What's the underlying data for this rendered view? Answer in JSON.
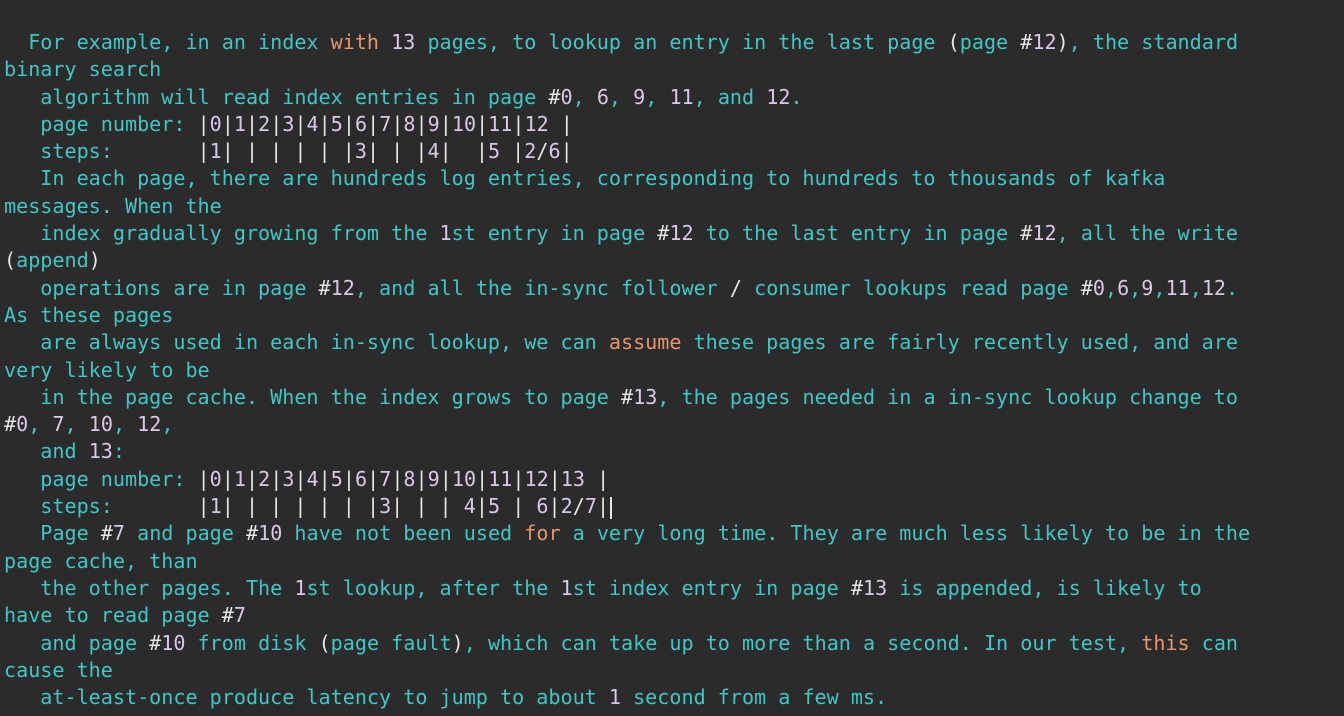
{
  "colors": {
    "background": "#2b2b2b",
    "text": "#3fc6c6",
    "symbol": "#e6e6e6",
    "number": "#d9c8e8",
    "keyword": "#e8956b"
  },
  "cursor": {
    "line": 17
  },
  "lines": [
    [
      [
        "t",
        "  For example, in an index "
      ],
      [
        "k",
        "with"
      ],
      [
        "t",
        " "
      ],
      [
        "n",
        "13"
      ],
      [
        "t",
        " pages, to lookup an entry in the last page "
      ],
      [
        "s",
        "("
      ],
      [
        "t",
        "page "
      ],
      [
        "s",
        "#"
      ],
      [
        "n",
        "12"
      ],
      [
        "s",
        ")"
      ],
      [
        "t",
        ", the standard"
      ]
    ],
    [
      [
        "t",
        "binary search"
      ]
    ],
    [
      [
        "t",
        "   algorithm will read index entries in page "
      ],
      [
        "s",
        "#"
      ],
      [
        "n",
        "0"
      ],
      [
        "t",
        ", "
      ],
      [
        "n",
        "6"
      ],
      [
        "t",
        ", "
      ],
      [
        "n",
        "9"
      ],
      [
        "t",
        ", "
      ],
      [
        "n",
        "11"
      ],
      [
        "t",
        ", and "
      ],
      [
        "n",
        "12"
      ],
      [
        "t",
        "."
      ]
    ],
    [
      [
        "t",
        "   page number: "
      ],
      [
        "s",
        "|"
      ],
      [
        "n",
        "0"
      ],
      [
        "s",
        "|"
      ],
      [
        "n",
        "1"
      ],
      [
        "s",
        "|"
      ],
      [
        "n",
        "2"
      ],
      [
        "s",
        "|"
      ],
      [
        "n",
        "3"
      ],
      [
        "s",
        "|"
      ],
      [
        "n",
        "4"
      ],
      [
        "s",
        "|"
      ],
      [
        "n",
        "5"
      ],
      [
        "s",
        "|"
      ],
      [
        "n",
        "6"
      ],
      [
        "s",
        "|"
      ],
      [
        "n",
        "7"
      ],
      [
        "s",
        "|"
      ],
      [
        "n",
        "8"
      ],
      [
        "s",
        "|"
      ],
      [
        "n",
        "9"
      ],
      [
        "s",
        "|"
      ],
      [
        "n",
        "10"
      ],
      [
        "s",
        "|"
      ],
      [
        "n",
        "11"
      ],
      [
        "s",
        "|"
      ],
      [
        "n",
        "12"
      ],
      [
        "s",
        " |"
      ]
    ],
    [
      [
        "t",
        "   steps:       "
      ],
      [
        "s",
        "|"
      ],
      [
        "n",
        "1"
      ],
      [
        "s",
        "| | | | | |"
      ],
      [
        "n",
        "3"
      ],
      [
        "s",
        "| | |"
      ],
      [
        "n",
        "4"
      ],
      [
        "s",
        "|  |"
      ],
      [
        "n",
        "5"
      ],
      [
        "s",
        " |"
      ],
      [
        "n",
        "2"
      ],
      [
        "s",
        "/"
      ],
      [
        "n",
        "6"
      ],
      [
        "s",
        "|"
      ]
    ],
    [
      [
        "t",
        "   In each page, there are hundreds log entries, corresponding to hundreds to thousands of kafka"
      ]
    ],
    [
      [
        "t",
        "messages. When the"
      ]
    ],
    [
      [
        "t",
        "   index gradually growing from the "
      ],
      [
        "n",
        "1"
      ],
      [
        "t",
        "st entry in page "
      ],
      [
        "s",
        "#"
      ],
      [
        "n",
        "12"
      ],
      [
        "t",
        " to the last entry in page "
      ],
      [
        "s",
        "#"
      ],
      [
        "n",
        "12"
      ],
      [
        "t",
        ", all the write"
      ]
    ],
    [
      [
        "s",
        "("
      ],
      [
        "t",
        "append"
      ],
      [
        "s",
        ")"
      ]
    ],
    [
      [
        "t",
        "   operations are in page "
      ],
      [
        "s",
        "#"
      ],
      [
        "n",
        "12"
      ],
      [
        "t",
        ", and all the in-sync follower "
      ],
      [
        "s",
        "/"
      ],
      [
        "t",
        " consumer lookups read page "
      ],
      [
        "s",
        "#"
      ],
      [
        "n",
        "0"
      ],
      [
        "t",
        ","
      ],
      [
        "n",
        "6"
      ],
      [
        "t",
        ","
      ],
      [
        "n",
        "9"
      ],
      [
        "t",
        ","
      ],
      [
        "n",
        "11"
      ],
      [
        "t",
        ","
      ],
      [
        "n",
        "12"
      ],
      [
        "t",
        "."
      ]
    ],
    [
      [
        "t",
        "As these pages"
      ]
    ],
    [
      [
        "t",
        "   are always used in each in-sync lookup, we can "
      ],
      [
        "k",
        "assume"
      ],
      [
        "t",
        " these pages are fairly recently used, and are"
      ]
    ],
    [
      [
        "t",
        "very likely to be"
      ]
    ],
    [
      [
        "t",
        "   in the page cache. When the index grows to page "
      ],
      [
        "s",
        "#"
      ],
      [
        "n",
        "13"
      ],
      [
        "t",
        ", the pages needed in a in-sync lookup change to"
      ]
    ],
    [
      [
        "s",
        "#"
      ],
      [
        "n",
        "0"
      ],
      [
        "t",
        ", "
      ],
      [
        "n",
        "7"
      ],
      [
        "t",
        ", "
      ],
      [
        "n",
        "10"
      ],
      [
        "t",
        ", "
      ],
      [
        "n",
        "12"
      ],
      [
        "t",
        ","
      ]
    ],
    [
      [
        "t",
        "   and "
      ],
      [
        "n",
        "13"
      ],
      [
        "t",
        ":"
      ]
    ],
    [
      [
        "t",
        "   page number: "
      ],
      [
        "s",
        "|"
      ],
      [
        "n",
        "0"
      ],
      [
        "s",
        "|"
      ],
      [
        "n",
        "1"
      ],
      [
        "s",
        "|"
      ],
      [
        "n",
        "2"
      ],
      [
        "s",
        "|"
      ],
      [
        "n",
        "3"
      ],
      [
        "s",
        "|"
      ],
      [
        "n",
        "4"
      ],
      [
        "s",
        "|"
      ],
      [
        "n",
        "5"
      ],
      [
        "s",
        "|"
      ],
      [
        "n",
        "6"
      ],
      [
        "s",
        "|"
      ],
      [
        "n",
        "7"
      ],
      [
        "s",
        "|"
      ],
      [
        "n",
        "8"
      ],
      [
        "s",
        "|"
      ],
      [
        "n",
        "9"
      ],
      [
        "s",
        "|"
      ],
      [
        "n",
        "10"
      ],
      [
        "s",
        "|"
      ],
      [
        "n",
        "11"
      ],
      [
        "s",
        "|"
      ],
      [
        "n",
        "12"
      ],
      [
        "s",
        "|"
      ],
      [
        "n",
        "13"
      ],
      [
        "s",
        " |"
      ]
    ],
    [
      [
        "t",
        "   steps:       "
      ],
      [
        "s",
        "|"
      ],
      [
        "n",
        "1"
      ],
      [
        "s",
        "| | | | | | |"
      ],
      [
        "n",
        "3"
      ],
      [
        "s",
        "| | | "
      ],
      [
        "n",
        "4"
      ],
      [
        "s",
        "|"
      ],
      [
        "n",
        "5"
      ],
      [
        "s",
        " | "
      ],
      [
        "n",
        "6"
      ],
      [
        "s",
        "|"
      ],
      [
        "n",
        "2"
      ],
      [
        "s",
        "/"
      ],
      [
        "n",
        "7"
      ],
      [
        "s",
        "|"
      ]
    ],
    [
      [
        "t",
        "   Page "
      ],
      [
        "s",
        "#"
      ],
      [
        "n",
        "7"
      ],
      [
        "t",
        " and page "
      ],
      [
        "s",
        "#"
      ],
      [
        "n",
        "10"
      ],
      [
        "t",
        " have not been used "
      ],
      [
        "k",
        "for"
      ],
      [
        "t",
        " a very long time. They are much less likely to be in the"
      ]
    ],
    [
      [
        "t",
        "page cache, than"
      ]
    ],
    [
      [
        "t",
        "   the other pages. The "
      ],
      [
        "n",
        "1"
      ],
      [
        "t",
        "st lookup, after the "
      ],
      [
        "n",
        "1"
      ],
      [
        "t",
        "st index entry in page "
      ],
      [
        "s",
        "#"
      ],
      [
        "n",
        "13"
      ],
      [
        "t",
        " is appended, is likely to"
      ]
    ],
    [
      [
        "t",
        "have to read page "
      ],
      [
        "s",
        "#"
      ],
      [
        "n",
        "7"
      ]
    ],
    [
      [
        "t",
        "   and page "
      ],
      [
        "s",
        "#"
      ],
      [
        "n",
        "10"
      ],
      [
        "t",
        " from disk "
      ],
      [
        "s",
        "("
      ],
      [
        "t",
        "page fault"
      ],
      [
        "s",
        ")"
      ],
      [
        "t",
        ", which can take up to more than a second. In our test, "
      ],
      [
        "k",
        "this"
      ],
      [
        "t",
        " can"
      ]
    ],
    [
      [
        "t",
        "cause the"
      ]
    ],
    [
      [
        "t",
        "   at-least-once produce latency to jump to about "
      ],
      [
        "n",
        "1"
      ],
      [
        "t",
        " second from a few ms."
      ]
    ]
  ]
}
